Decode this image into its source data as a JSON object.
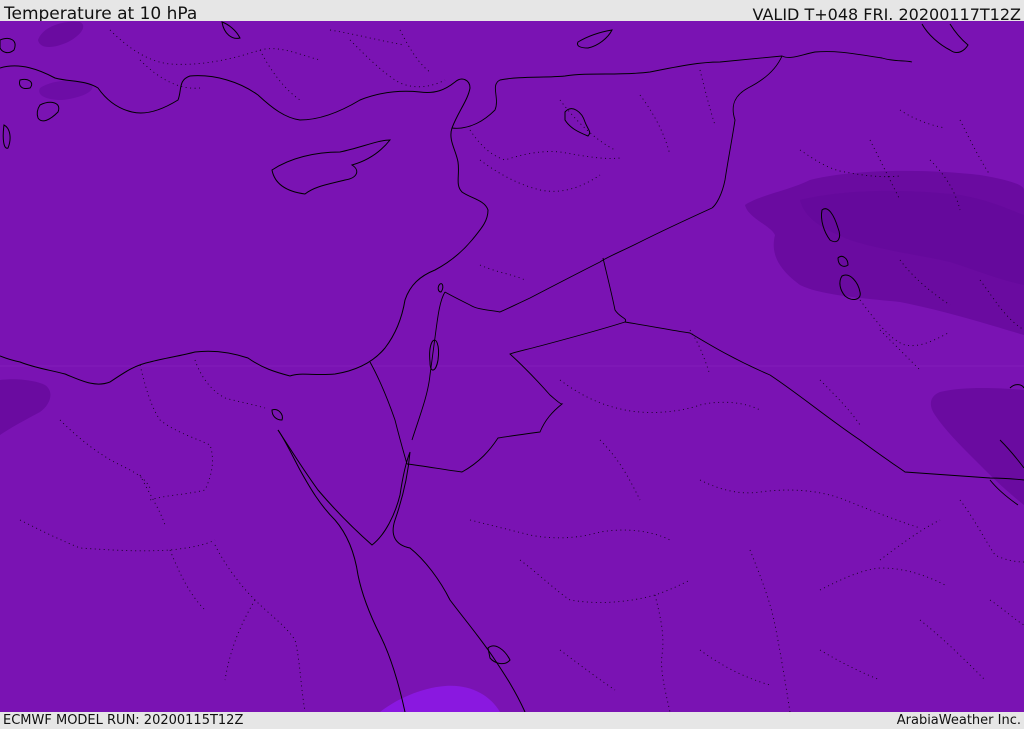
{
  "header": {
    "title": "Temperature at 10 hPa",
    "valid": "VALID T+048 FRI. 20200117T12Z"
  },
  "footer": {
    "model_run": "ECMWF MODEL RUN: 20200115T12Z",
    "credit": "ArabiaWeather Inc."
  },
  "colors": {
    "background_field": "#7a13b3",
    "cold_pocket": "#6a0ba0",
    "warm_patch": "#8a18e0",
    "coastline": "#000000",
    "frame": "#e6e6e6"
  }
}
